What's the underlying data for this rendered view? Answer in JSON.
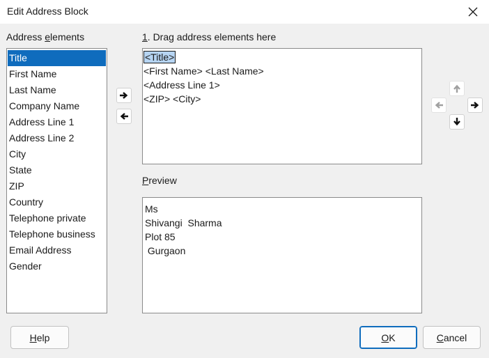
{
  "window": {
    "title": "Edit Address Block",
    "close_icon": "close-icon"
  },
  "address_elements": {
    "label_underlined_prefix": "Address ",
    "label_accel": "e",
    "label_rest": "lements",
    "items": [
      {
        "label": "Title",
        "selected": true
      },
      {
        "label": "First Name"
      },
      {
        "label": "Last Name"
      },
      {
        "label": "Company Name"
      },
      {
        "label": "Address Line 1"
      },
      {
        "label": "Address Line 2"
      },
      {
        "label": "City"
      },
      {
        "label": "State"
      },
      {
        "label": "ZIP"
      },
      {
        "label": "Country"
      },
      {
        "label": "Telephone private"
      },
      {
        "label": "Telephone business"
      },
      {
        "label": "Email Address"
      },
      {
        "label": "Gender"
      }
    ]
  },
  "drag_area": {
    "label_accel": "1",
    "label_rest": ". Drag address elements here",
    "line1_selected": "<Title>",
    "line2": "<First Name> <Last Name>",
    "line3": "<Address Line 1>",
    "line4": "<ZIP> <City>"
  },
  "preview": {
    "label_accel": "P",
    "label_rest": "review",
    "lines": [
      "Ms",
      "Shivangi  Sharma",
      "Plot 85",
      " Gurgaon"
    ]
  },
  "buttons": {
    "help_accel": "H",
    "help_rest": "elp",
    "ok_accel": "O",
    "ok_rest": "K",
    "cancel_accel": "C",
    "cancel_rest": "ancel"
  },
  "colors": {
    "selection": "#0f6cbd",
    "token_highlight": "#b6d4f2",
    "disabled_arrow": "#a0a0a0"
  }
}
